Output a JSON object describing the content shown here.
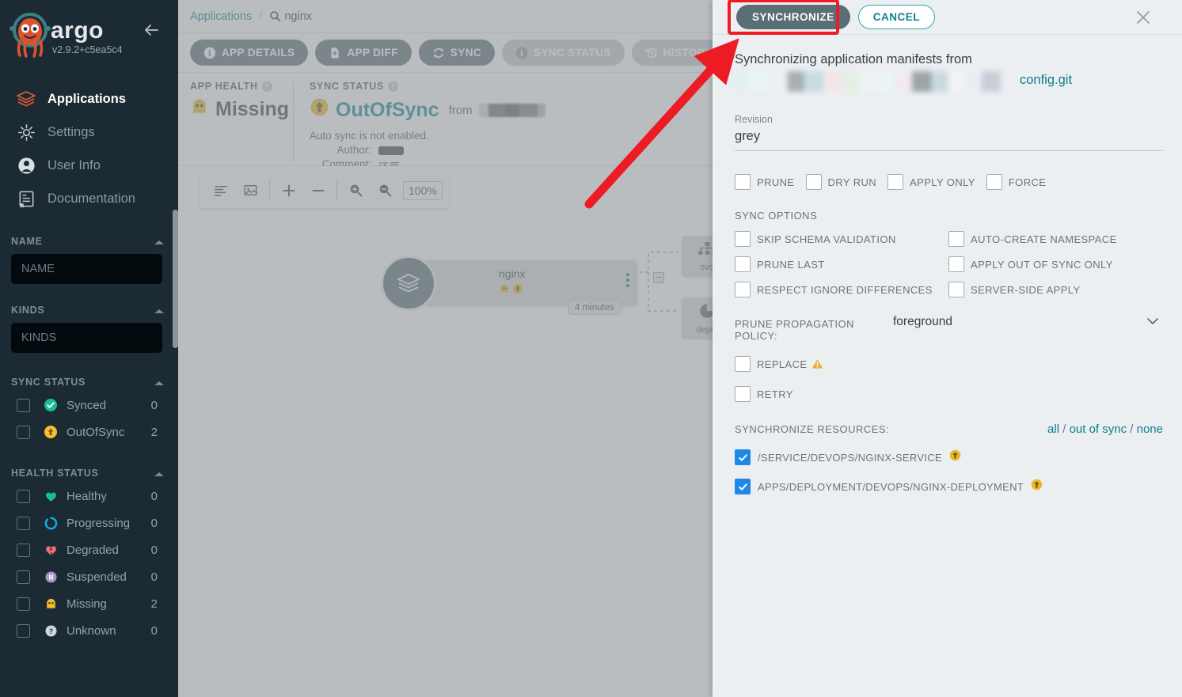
{
  "sidebar": {
    "brand": "argo",
    "version": "v2.9.2+c5ea5c4",
    "collapse_icon": "arrow-left-icon",
    "nav": [
      {
        "label": "Applications",
        "icon": "layers-icon",
        "active": true
      },
      {
        "label": "Settings",
        "icon": "gear-icon",
        "active": false
      },
      {
        "label": "User Info",
        "icon": "user-circle-icon",
        "active": false
      },
      {
        "label": "Documentation",
        "icon": "book-icon",
        "active": false
      }
    ],
    "filters": {
      "name": {
        "title": "NAME",
        "placeholder": "NAME",
        "value": ""
      },
      "kinds": {
        "title": "KINDS",
        "placeholder": "KINDS",
        "value": ""
      },
      "sync_status": {
        "title": "SYNC STATUS",
        "rows": [
          {
            "label": "Synced",
            "count": "0",
            "icon": "synced-check-icon",
            "color": "#18be94",
            "checked": false
          },
          {
            "label": "OutOfSync",
            "count": "2",
            "icon": "outofsync-arrow-icon",
            "color": "#f4c030",
            "checked": false
          }
        ]
      },
      "health_status": {
        "title": "HEALTH STATUS",
        "rows": [
          {
            "label": "Healthy",
            "count": "0",
            "icon": "heart-icon",
            "color": "#18be94",
            "checked": false
          },
          {
            "label": "Progressing",
            "count": "0",
            "icon": "circle-notch-icon",
            "color": "#0dadea",
            "checked": false
          },
          {
            "label": "Degraded",
            "count": "0",
            "icon": "heart-broken-icon",
            "color": "#e96d76",
            "checked": false
          },
          {
            "label": "Suspended",
            "count": "0",
            "icon": "pause-circle-icon",
            "color": "#a695c4",
            "checked": false
          },
          {
            "label": "Missing",
            "count": "2",
            "icon": "ghost-icon",
            "color": "#f4c030",
            "checked": false
          },
          {
            "label": "Unknown",
            "count": "0",
            "icon": "question-circle-icon",
            "color": "#ccd6dd",
            "checked": false
          }
        ]
      }
    }
  },
  "main": {
    "breadcrumb": {
      "root": "Applications",
      "separator": "/",
      "current": "nginx",
      "search_icon": "magnifier-icon"
    },
    "toolbar": [
      {
        "label": "APP DETAILS",
        "icon": "info-icon",
        "style": "dark"
      },
      {
        "label": "APP DIFF",
        "icon": "file-diff-icon",
        "style": "dark"
      },
      {
        "label": "SYNC",
        "icon": "refresh-icon",
        "style": "dark"
      },
      {
        "label": "SYNC STATUS",
        "icon": "info-icon",
        "style": "light"
      },
      {
        "label": "HISTORY AND ROLLBACK",
        "icon": "history-icon",
        "style": "light"
      }
    ],
    "status": {
      "health_label": "APP HEALTH",
      "health_value": "Missing",
      "health_icon": "ghost-icon",
      "sync_label": "SYNC STATUS",
      "sync_value": "OutOfSync",
      "sync_icon": "outofsync-arrow-icon",
      "from_label": "from",
      "auto_sync": "Auto sync is not enabled.",
      "author_key": "Author:",
      "author_value": "",
      "comment_key": "Comment:",
      "comment_value": "还原",
      "overflow_icon": "ellipsis-icon"
    },
    "graph_toolbar": {
      "align_icon": "align-left-icon",
      "fit_icon": "fit-to-screen-icon",
      "plus_icon": "plus-icon",
      "minus_icon": "minus-icon",
      "zoom_in_icon": "magnifier-plus-icon",
      "zoom_out_icon": "magnifier-minus-icon",
      "zoom_level": "100%"
    },
    "graph": {
      "app_node": {
        "name": "nginx",
        "icon": "layers-icon",
        "badges": [
          "ghost-icon",
          "outofsync-arrow-icon"
        ],
        "time": "4 minutes",
        "kebab_icon": "kebab-menu-icon",
        "collapse_icon": "minus-box-icon"
      },
      "child_nodes": [
        {
          "label": "svc",
          "icon": "sitemap-icon"
        },
        {
          "label": "deplo",
          "icon": "deployment-icon"
        }
      ]
    }
  },
  "panel": {
    "synchronize_label": "SYNCHRONIZE",
    "cancel_label": "CANCEL",
    "close_icon": "close-icon",
    "heading": "Synchronizing application manifests from",
    "repo_link": "config.git",
    "revision_label": "Revision",
    "revision_value": "grey",
    "top_options": [
      {
        "label": "PRUNE",
        "checked": false
      },
      {
        "label": "DRY RUN",
        "checked": false
      },
      {
        "label": "APPLY ONLY",
        "checked": false
      },
      {
        "label": "FORCE",
        "checked": false
      }
    ],
    "sync_options_title": "SYNC OPTIONS",
    "sync_options": [
      {
        "label": "SKIP SCHEMA VALIDATION",
        "checked": false
      },
      {
        "label": "AUTO-CREATE NAMESPACE",
        "checked": false
      },
      {
        "label": "PRUNE LAST",
        "checked": false
      },
      {
        "label": "APPLY OUT OF SYNC ONLY",
        "checked": false
      },
      {
        "label": "RESPECT IGNORE DIFFERENCES",
        "checked": false
      },
      {
        "label": "SERVER-SIDE APPLY",
        "checked": false
      }
    ],
    "prune_policy_label": "PRUNE PROPAGATION POLICY:",
    "prune_policy_value": "foreground",
    "prune_policy_caret_icon": "chevron-down-icon",
    "replace_label": "REPLACE",
    "replace_checked": false,
    "replace_warning_icon": "warning-triangle-icon",
    "retry_label": "RETRY",
    "retry_checked": false,
    "resources_label": "SYNCHRONIZE RESOURCES:",
    "resource_links": {
      "all": "all",
      "out_of_sync": "out of sync",
      "none": "none",
      "separator": "/"
    },
    "resources": [
      {
        "label": "/SERVICE/DEVOPS/NGINX-SERVICE",
        "checked": true,
        "status_icon": "outofsync-arrow-icon"
      },
      {
        "label": "APPS/DEPLOYMENT/DEVOPS/NGINX-DEPLOYMENT",
        "checked": true,
        "status_icon": "outofsync-arrow-icon"
      }
    ]
  },
  "annotations": {
    "highlight_color": "#ed1c24",
    "highlight_target": "SYNCHRONIZE",
    "arrow_icon": "red-arrow-annotation"
  },
  "colors": {
    "sidebar_bg": "#1c2b33",
    "panel_bg": "#eceff1",
    "accent_teal": "#0d7d8f",
    "button_dark": "#5a6e78",
    "checked_blue": "#1e88e5",
    "warning_yellow": "#f4c030",
    "healthy_green": "#18be94",
    "annotation_red": "#ed1c24"
  }
}
